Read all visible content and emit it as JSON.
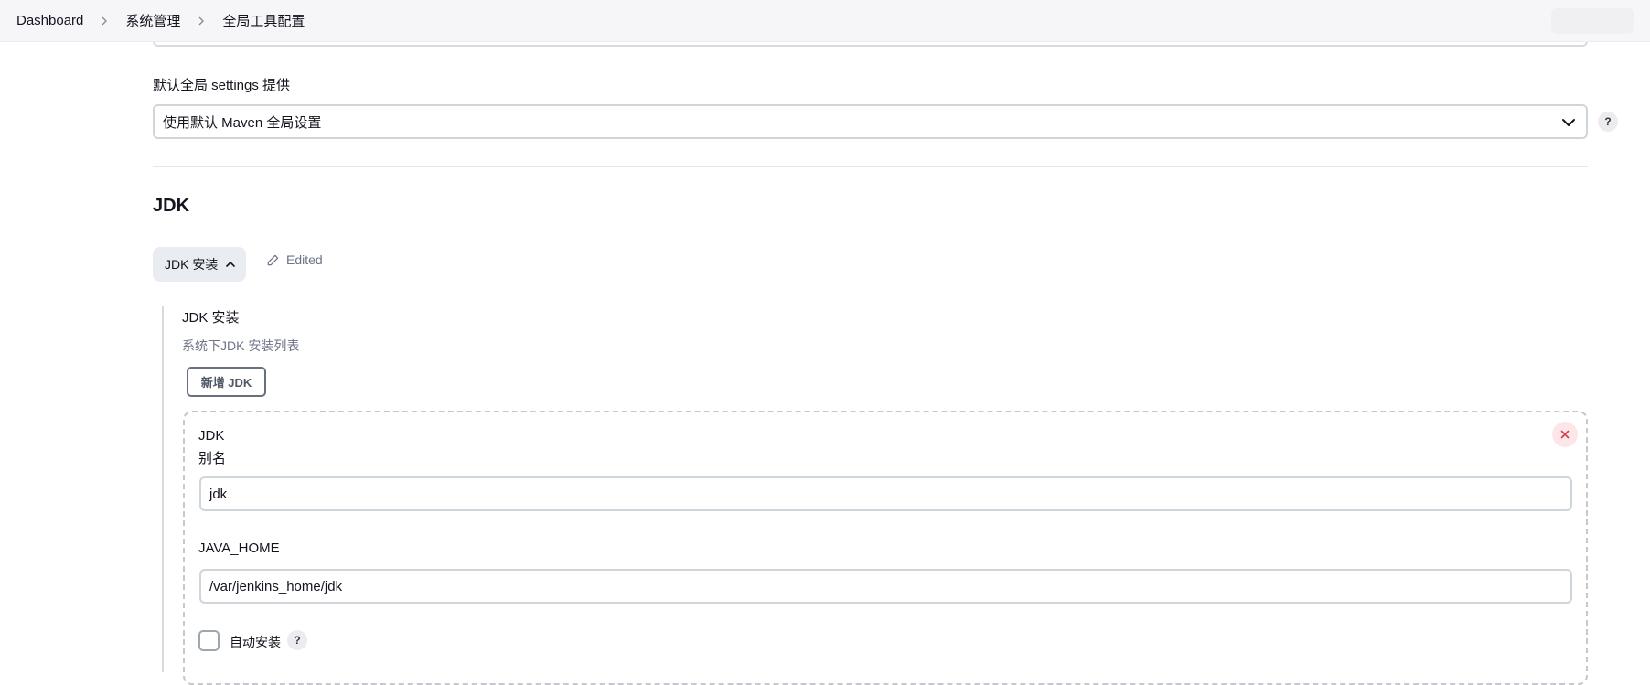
{
  "breadcrumb": {
    "items": [
      "Dashboard",
      "系统管理",
      "全局工具配置"
    ]
  },
  "maven_settings": {
    "label": "默认全局 settings 提供",
    "selected": "使用默认 Maven 全局设置",
    "help": "?"
  },
  "jdk_section": {
    "title": "JDK",
    "toggle_label": "JDK 安装",
    "edited_label": "Edited",
    "field_title": "JDK 安装",
    "description": "系统下JDK 安装列表",
    "add_button": "新增 JDK",
    "entry": {
      "heading": "JDK",
      "alias_label": "别名",
      "alias_value": "jdk",
      "java_home_label": "JAVA_HOME",
      "java_home_value": "/var/jenkins_home/jdk",
      "auto_install_label": "自动安装",
      "auto_install_checked": false,
      "help": "?"
    }
  },
  "colors": {
    "accent_border": "#ced6dc",
    "muted_text": "#6e7387",
    "danger": "#d23b4a",
    "danger_bg": "#fde6e8"
  },
  "icons": {
    "breadcrumb_separator": "chevron-right-icon",
    "select": "chevron-down-icon",
    "toggle": "chevron-up-icon",
    "edited": "pencil-icon",
    "close": "close-icon"
  }
}
